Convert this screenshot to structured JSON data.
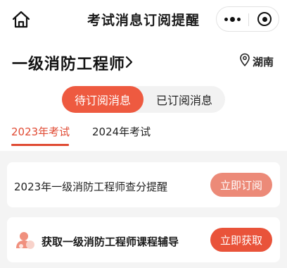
{
  "nav": {
    "title": "考试消息订阅提醒",
    "home_icon": "home-icon",
    "more_icon": "more-dots-icon",
    "close_icon": "target-icon"
  },
  "exam": {
    "name": "一级消防工程师",
    "chevron_icon": "chevron-right-icon",
    "location_icon": "location-pin-icon",
    "location": "湖南"
  },
  "toggle": {
    "options": [
      "待订阅消息",
      "已订阅消息"
    ],
    "selected": "待订阅消息"
  },
  "year_tabs": {
    "items": [
      "2023年考试",
      "2024年考试"
    ],
    "selected": "2023年考试"
  },
  "cards": [
    {
      "text": "2023年一级消防工程师查分提醒",
      "button": "立即订阅"
    },
    {
      "text": "获取一级消防工程师课程辅导",
      "button": "立即获取",
      "icon": "person-icon"
    }
  ],
  "colors": {
    "accent": "#e9533a",
    "accent_light": "#ec8a78",
    "background": "#f4f4f4"
  }
}
